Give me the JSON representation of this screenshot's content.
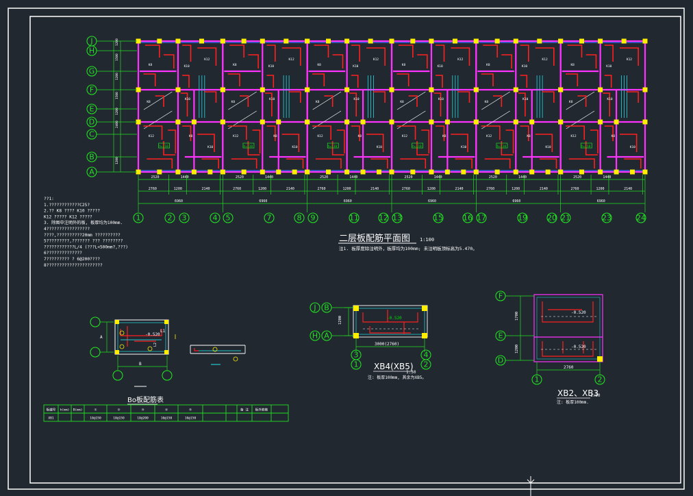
{
  "main_plan": {
    "title": "二层板配筋平面图",
    "scale": "1:100",
    "note": "注1. 板厚度除注明外，板厚均为100mm; 未注明板顶标高为5.470。",
    "row_axes": [
      "J",
      "H",
      "G",
      "F",
      "E",
      "D",
      "C",
      "B",
      "A"
    ],
    "col_axes": [
      "1",
      "2",
      "3",
      "4",
      "5",
      "7",
      "8",
      "9",
      "11",
      "12",
      "13",
      "15",
      "16",
      "17",
      "19",
      "20",
      "21",
      "23",
      "24"
    ],
    "unit_dims": [
      "2520",
      "1440",
      "2760",
      "1200",
      "2140"
    ],
    "unit_total": "6960",
    "left_dims": [
      "1200",
      "1500",
      "1200",
      "1500",
      "1200",
      "2400",
      "1200"
    ],
    "plate_labels": [
      "K8",
      "K10",
      "K12",
      "h=110"
    ]
  },
  "notes": {
    "lines": [
      "??1:",
      "1.????????????C25?",
      "2.?? K8 ????  K10 ?????",
      "     K12 ????? K12 ?????",
      "3. 除图中注明外的板, 板厚均为100mm.",
      "4?????????????????",
      "     ????,??????????20mm      ??????????",
      "5?????????,???????          ???  ????????",
      "     ????????????L/4          (???L<500mm?,???)",
      "6??????????????",
      "7?????????  ?  6@200????",
      "8??????????????????????"
    ]
  },
  "detail_b": {
    "dim_label": "B",
    "side_label": "A",
    "elev_label": "-0.520",
    "lengths": [
      "L1",
      "L2"
    ],
    "table_title": "Bo板配筋表",
    "table_headers": [
      "板编号",
      "h(mm)",
      "B(mm)",
      "①",
      "②",
      "③",
      "④",
      "⑤",
      "",
      "",
      "备 注",
      "板外筋筋"
    ],
    "table_row": [
      "XB1",
      "",
      "",
      "10@150",
      "10@150",
      "10@200",
      "10@150",
      "10@150",
      "",
      "",
      "",
      ""
    ]
  },
  "detail_xb4": {
    "title": "XB4(XB5)",
    "scale": "1:50",
    "note": "注: 板厚100mm, 其余为XB5。",
    "row_axes": [
      "J",
      "B",
      "H",
      "A"
    ],
    "col_axes": [
      "3",
      "4",
      "1",
      "2"
    ],
    "elev": "-0.520",
    "dim": "3000(2760)",
    "left_dim": "1200"
  },
  "detail_xb2": {
    "title": "XB2、XB3",
    "scale": "1:50",
    "note": "注: 板厚100mm.",
    "row_axes": [
      "F",
      "E",
      "D"
    ],
    "col_axes": [
      "1",
      "2"
    ],
    "elev_upper": "-0.520",
    "elev_lower": "-0.520",
    "dim": "2760",
    "left_dims": [
      "1700",
      "1200"
    ]
  },
  "colors": {
    "background": "#212830",
    "frame": "#ffffff",
    "axis_green": "#22e022",
    "wall_magenta": "#ff33ff",
    "rebar_red": "#ff2020",
    "column_yellow": "#ffee00",
    "beam_blue": "#3b6cff",
    "cyan": "#22c8d0"
  }
}
